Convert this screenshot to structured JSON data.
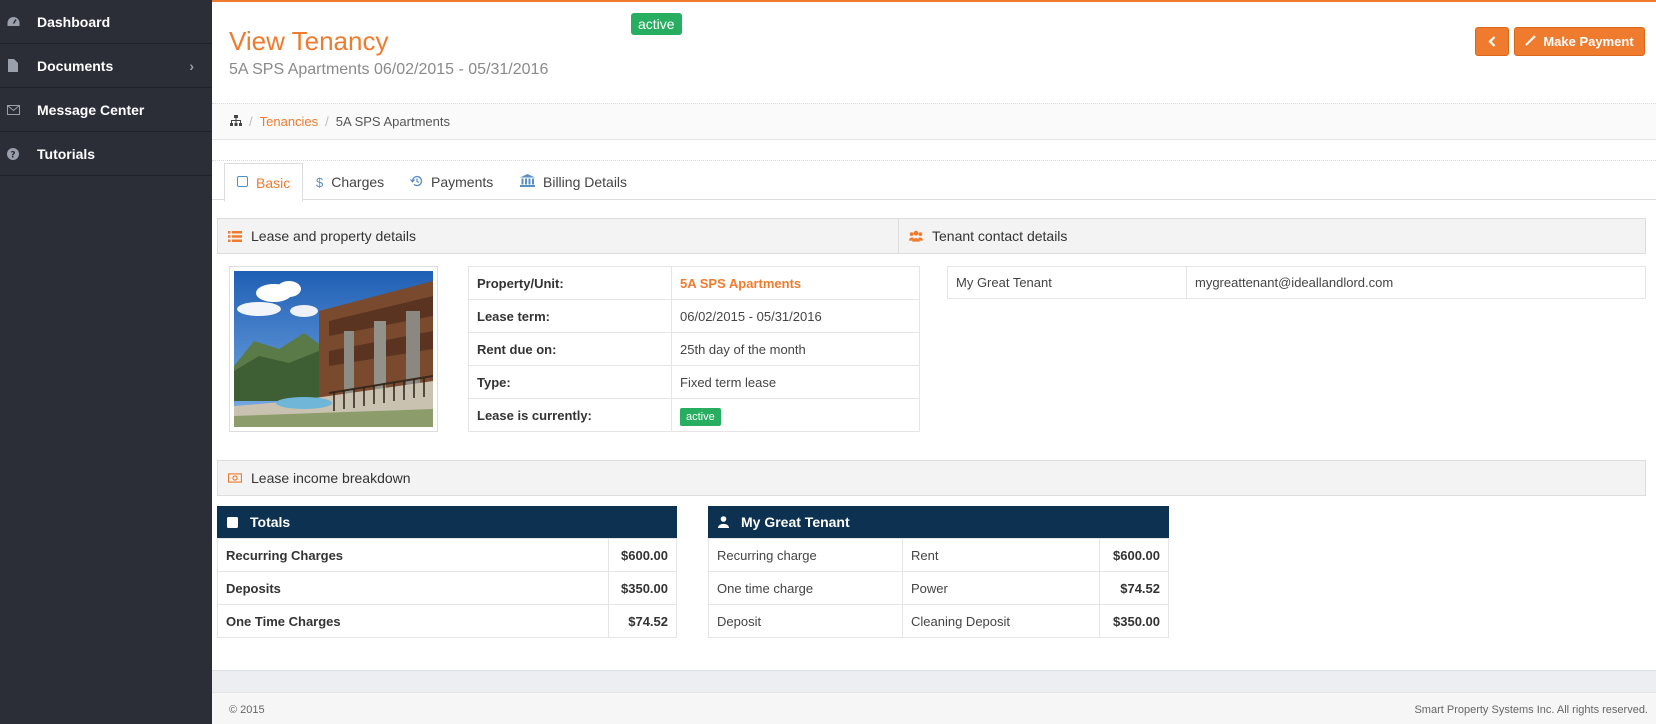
{
  "sidebar": {
    "items": [
      {
        "label": "Dashboard",
        "icon": "dashboard-icon"
      },
      {
        "label": "Documents",
        "icon": "file-icon"
      },
      {
        "label": "Message Center",
        "icon": "envelope-icon"
      },
      {
        "label": "Tutorials",
        "icon": "question-icon"
      }
    ]
  },
  "header": {
    "title": "View Tenancy",
    "subtitle": "5A SPS Apartments 06/02/2015 - 05/31/2016",
    "status_badge": "active",
    "back_icon": "chevron-left-icon",
    "make_payment_label": "Make Payment"
  },
  "breadcrumb": {
    "home_icon": "sitemap-icon",
    "items": [
      "Tenancies",
      "5A SPS Apartments"
    ]
  },
  "tabs": [
    {
      "label": "Basic",
      "icon": "square-icon",
      "active": true
    },
    {
      "label": "Charges",
      "icon": "dollar-icon",
      "active": false
    },
    {
      "label": "Payments",
      "icon": "history-icon",
      "active": false
    },
    {
      "label": "Billing Details",
      "icon": "bank-icon",
      "active": false
    }
  ],
  "lease_section": {
    "title": "Lease and property details",
    "rows": [
      {
        "key": "Property/Unit:",
        "value": "5A SPS Apartments"
      },
      {
        "key": "Lease term:",
        "value": "06/02/2015 - 05/31/2016"
      },
      {
        "key": "Rent due on:",
        "value": "25th day of the month"
      },
      {
        "key": "Type:",
        "value": "Fixed term lease"
      },
      {
        "key": "Lease is currently:",
        "value": "active"
      }
    ]
  },
  "tenant_section": {
    "title": "Tenant contact details",
    "name": "My Great Tenant",
    "email": "mygreattenant@ideallandlord.com"
  },
  "income_section": {
    "title": "Lease income breakdown",
    "totals": {
      "title": "Totals",
      "rows": [
        {
          "label": "Recurring Charges",
          "amount": "$600.00"
        },
        {
          "label": "Deposits",
          "amount": "$350.00"
        },
        {
          "label": "One Time Charges",
          "amount": "$74.52"
        }
      ]
    },
    "tenant": {
      "title": "My Great Tenant",
      "rows": [
        {
          "type": "Recurring charge",
          "name": "Rent",
          "amount": "$600.00"
        },
        {
          "type": "One time charge",
          "name": "Power",
          "amount": "$74.52"
        },
        {
          "type": "Deposit",
          "name": "Cleaning Deposit",
          "amount": "$350.00"
        }
      ]
    }
  },
  "footer": {
    "left": "© 2015",
    "right": "Smart Property Systems Inc. All rights reserved."
  },
  "colors": {
    "accent": "#ef7b2e",
    "sidebar": "#2b2d37",
    "dark_header": "#0d3150",
    "success": "#27ae60"
  }
}
